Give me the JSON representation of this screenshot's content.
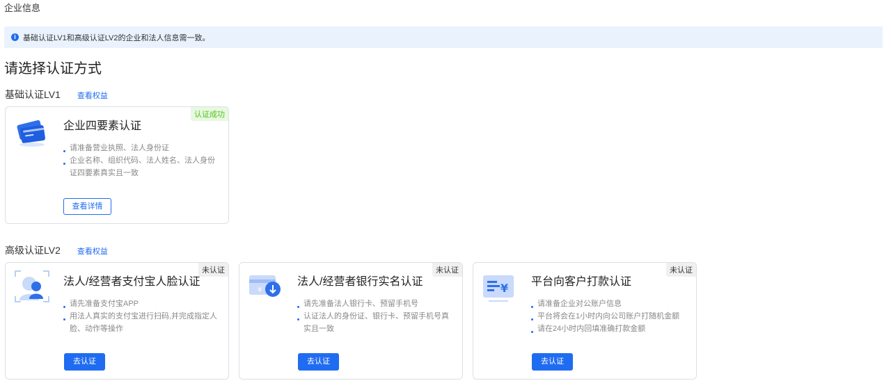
{
  "header": {
    "title": "企业信息"
  },
  "notice": {
    "icon": "info-icon",
    "text": "基础认证LV1和高级认证LV2的企业和法人信息需一致。"
  },
  "section_title": "请选择认证方式",
  "lv1": {
    "title": "基础认证LV1",
    "link": "查看权益",
    "cards": [
      {
        "title": "企业四要素认证",
        "status": "认证成功",
        "icon": "id-cards-icon",
        "bullets": [
          "请准备营业执照、法人身份证",
          "企业名称、组织代码、法人姓名、法人身份证四要素真实且一致"
        ],
        "button": "查看详情"
      }
    ]
  },
  "lv2": {
    "title": "高级认证LV2",
    "link": "查看权益",
    "cards": [
      {
        "title": "法人/经营者支付宝人脸认证",
        "status": "未认证",
        "icon": "face-scan-icon",
        "bullets": [
          "请先准备支付宝APP",
          "用法人真实的支付宝进行扫码,并完成指定人脸、动作等操作"
        ],
        "button": "去认证"
      },
      {
        "title": "法人/经营者银行实名认证",
        "status": "未认证",
        "icon": "bank-card-user-icon",
        "bullets": [
          "请先准备法人银行卡、预留手机号",
          "认证法人的身份证、银行卡、预留手机号真实且一致"
        ],
        "button": "去认证"
      },
      {
        "title": "平台向客户打款认证",
        "status": "未认证",
        "icon": "yuan-transfer-icon",
        "bullets": [
          "请准备企业对公账户信息",
          "平台将会在1小时内向公司账户打随机金额",
          "请在24小时内回填准确打款金额"
        ],
        "button": "去认证"
      }
    ]
  },
  "colors": {
    "primary": "#1f6cf1",
    "success": "#52c41a",
    "notice_bg": "#eaf3fd"
  }
}
